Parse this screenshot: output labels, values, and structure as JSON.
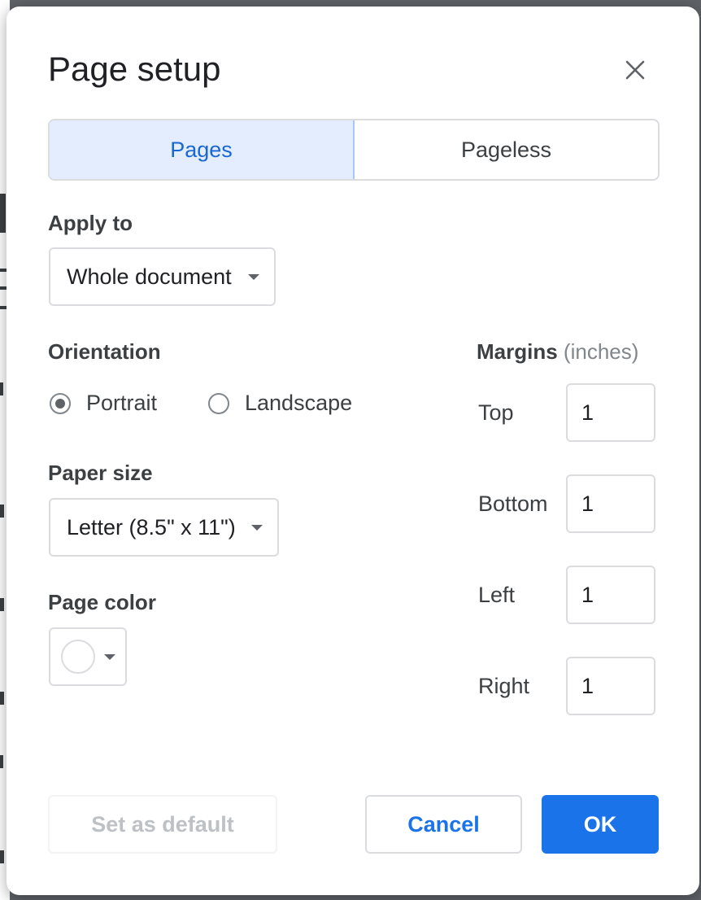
{
  "dialog": {
    "title": "Page setup",
    "close_icon": "close-icon"
  },
  "tabs": [
    {
      "label": "Pages",
      "active": true
    },
    {
      "label": "Pageless",
      "active": false
    }
  ],
  "apply_to": {
    "label": "Apply to",
    "selected": "Whole document"
  },
  "orientation": {
    "label": "Orientation",
    "options": [
      {
        "label": "Portrait",
        "checked": true
      },
      {
        "label": "Landscape",
        "checked": false
      }
    ]
  },
  "paper_size": {
    "label": "Paper size",
    "selected": "Letter (8.5\" x 11\")"
  },
  "page_color": {
    "label": "Page color",
    "value": "#ffffff"
  },
  "margins": {
    "label": "Margins",
    "unit": "(inches)",
    "fields": [
      {
        "label": "Top",
        "value": "1"
      },
      {
        "label": "Bottom",
        "value": "1"
      },
      {
        "label": "Left",
        "value": "1"
      },
      {
        "label": "Right",
        "value": "1"
      }
    ]
  },
  "buttons": {
    "set_default": "Set as default",
    "cancel": "Cancel",
    "ok": "OK"
  },
  "colors": {
    "accent": "#1a73e8",
    "active_tab_bg": "#e3edfd",
    "border": "#dadce0"
  }
}
